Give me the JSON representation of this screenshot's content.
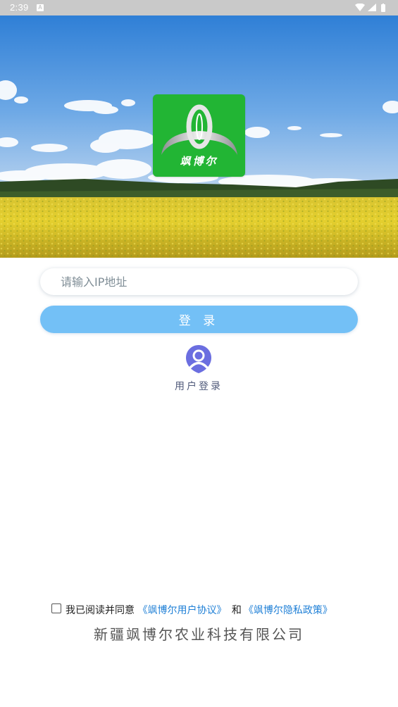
{
  "status_bar": {
    "time": "2:39",
    "notification_icon": "a-icon",
    "icons": [
      "wifi-icon",
      "signal-icon",
      "battery-icon"
    ]
  },
  "logo": {
    "text": "飒博尔",
    "background_color": "#22b534"
  },
  "form": {
    "ip_placeholder": "请输入IP地址",
    "ip_value": "",
    "login_button_label": "登 录",
    "login_button_color": "#73c0f6"
  },
  "user_login": {
    "icon": "user-icon",
    "label": "用户登录",
    "icon_color": "#6b6ee0"
  },
  "agreement": {
    "checked": false,
    "prefix": "我已阅读并同意",
    "user_agreement_link": "《飒博尔用户协议》",
    "and_text": "和",
    "privacy_policy_link": "《飒博尔隐私政策》",
    "link_color": "#1e7fd6"
  },
  "footer": {
    "company_name": "新疆飒博尔农业科技有限公司"
  }
}
